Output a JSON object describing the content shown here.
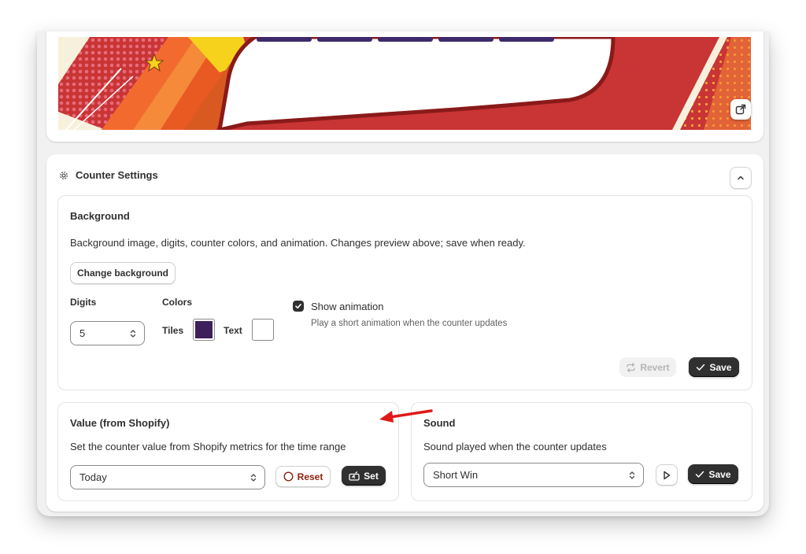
{
  "settings": {
    "title": "Counter Settings"
  },
  "background": {
    "title": "Background",
    "description": "Background image, digits, counter colors, and animation. Changes preview above; save when ready.",
    "change_button": "Change background",
    "digits_label": "Digits",
    "digits_value": "5",
    "colors_label": "Colors",
    "tiles_label": "Tiles",
    "tiles_color": "#3d1f5c",
    "text_label": "Text",
    "text_color": "#ffffff",
    "animation_label": "Show animation",
    "animation_checked": true,
    "animation_help": "Play a short animation when the counter updates",
    "revert_button": "Revert",
    "save_button": "Save"
  },
  "value": {
    "title": "Value (from Shopify)",
    "description": "Set the counter value from Shopify metrics for the time range",
    "range_value": "Today",
    "reset_button": "Reset",
    "set_button": "Set"
  },
  "sound": {
    "title": "Sound",
    "description": "Sound played when the counter updates",
    "sound_value": "Short Win",
    "save_button": "Save"
  },
  "colors": {
    "accent_dark": "#303030",
    "critical": "#8e1f0b",
    "annotation_arrow": "#e01919"
  },
  "icons": [
    "external-link-icon",
    "gear-icon",
    "chevron-up-icon",
    "select-chevrons-icon",
    "check-icon",
    "revert-icon",
    "reset-circle-icon",
    "set-icon",
    "play-icon",
    "annotation-arrow"
  ]
}
